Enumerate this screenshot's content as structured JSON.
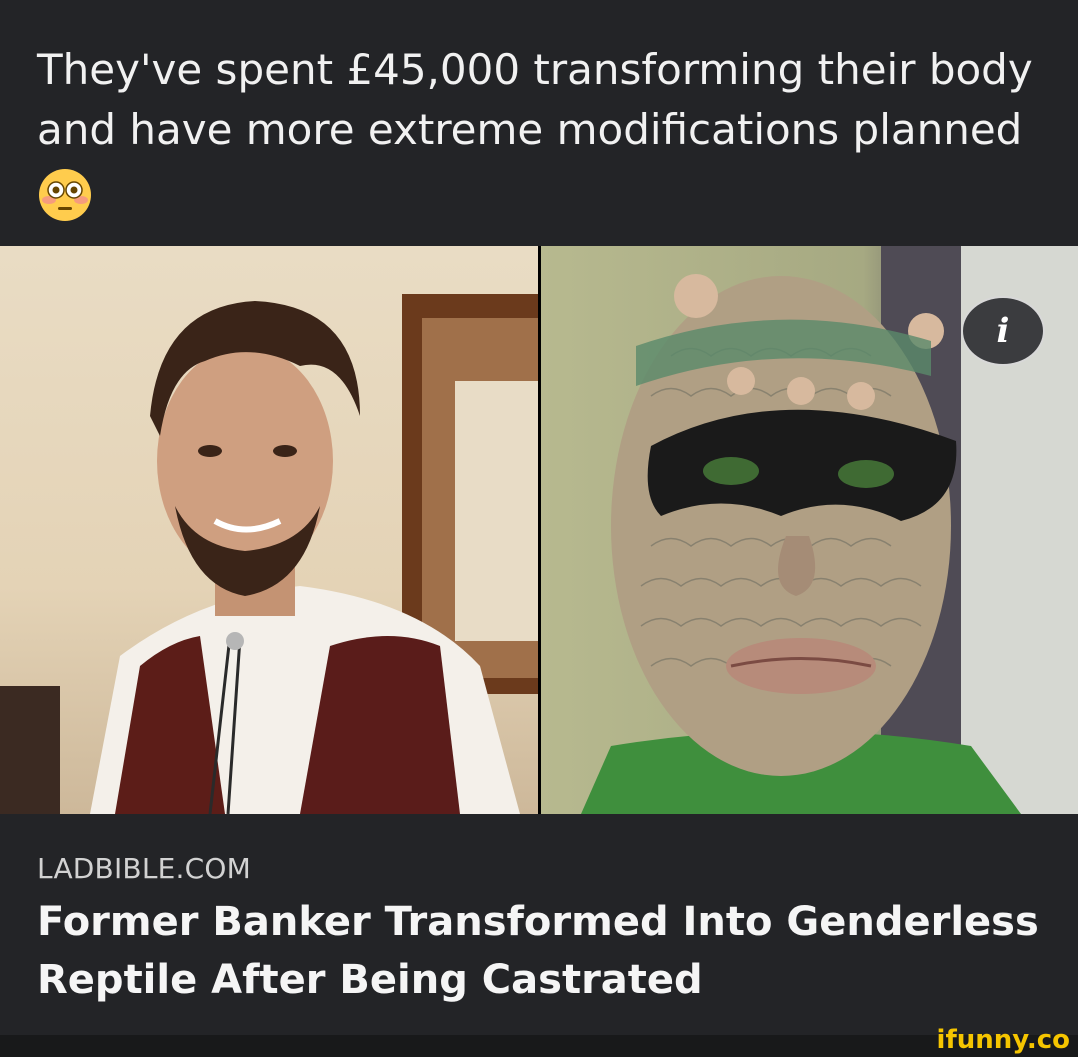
{
  "post": {
    "caption": "They've spent £45,000 transforming their body and have more extreme modifications planned",
    "emoji_icon": "flushed-face-emoji"
  },
  "link_card": {
    "source": "LADBIBLE.COM",
    "headline": "Former Banker Transformed Into Genderless Reptile After Being Castrated",
    "info_icon_label": "i"
  },
  "watermark": {
    "text": "ifunny.co",
    "color": "#f5c500"
  },
  "colors": {
    "background": "#232427",
    "text": "#f1f1f1"
  }
}
